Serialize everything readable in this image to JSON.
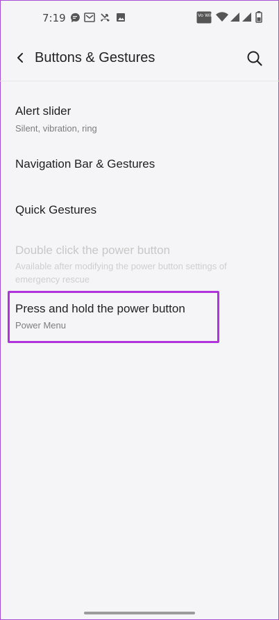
{
  "status_bar": {
    "time": "7:19",
    "notification_icons": [
      "chat-bubble-icon",
      "gallery-mail-icon",
      "missed-call-icon",
      "image-icon"
    ],
    "system_icons": [
      "volte-wifi-icon",
      "wifi-icon",
      "signal-icon",
      "signal-icon",
      "battery-icon"
    ],
    "volte_label": "Vo WiFi"
  },
  "app_bar": {
    "title": "Buttons & Gestures",
    "back_icon": "back-arrow-icon",
    "search_icon": "search-icon"
  },
  "settings": {
    "items": [
      {
        "title": "Alert slider",
        "subtitle": "Silent, vibration, ring",
        "enabled": true
      },
      {
        "title": "Navigation Bar & Gestures",
        "subtitle": "",
        "enabled": true
      },
      {
        "title": "Quick Gestures",
        "subtitle": "",
        "enabled": true
      },
      {
        "title": "Double click the power button",
        "subtitle": "Available after modifying the power button settings of emergency rescue",
        "enabled": false
      },
      {
        "title": "Press and hold the power button",
        "subtitle": "Power Menu",
        "enabled": true,
        "highlighted": true
      }
    ]
  },
  "colors": {
    "highlight": "#b133dc",
    "background": "#f5f4f6"
  }
}
